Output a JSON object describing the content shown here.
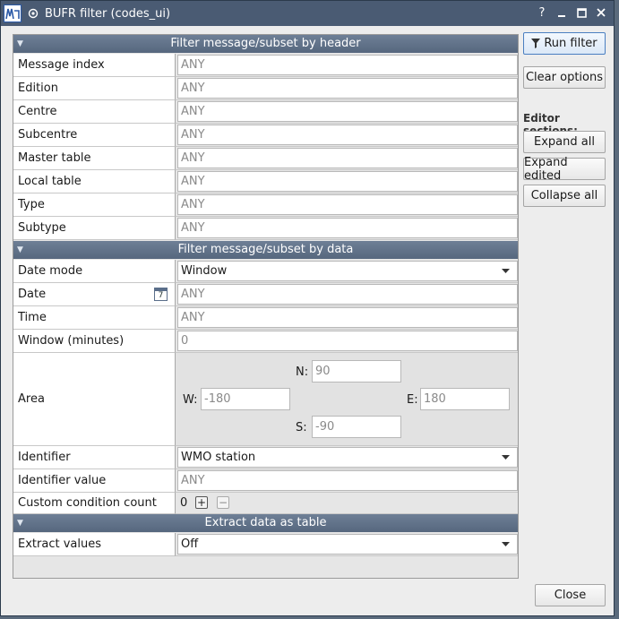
{
  "window": {
    "title": "BUFR filter (codes_ui)",
    "help": "?",
    "minimize": "_",
    "maximize": "□",
    "close": "✕"
  },
  "sections": {
    "header": {
      "title": "Filter message/subset by header"
    },
    "data": {
      "title": "Filter message/subset by data"
    },
    "extract": {
      "title": "Extract data as table"
    }
  },
  "header_rows": [
    {
      "label": "Message index",
      "placeholder": "ANY"
    },
    {
      "label": "Edition",
      "placeholder": "ANY"
    },
    {
      "label": "Centre",
      "placeholder": "ANY"
    },
    {
      "label": "Subcentre",
      "placeholder": "ANY"
    },
    {
      "label": "Master table",
      "placeholder": "ANY"
    },
    {
      "label": "Local table",
      "placeholder": "ANY"
    },
    {
      "label": "Type",
      "placeholder": "ANY"
    },
    {
      "label": "Subtype",
      "placeholder": "ANY"
    }
  ],
  "data_rows": {
    "date_mode": {
      "label": "Date mode",
      "value": "Window"
    },
    "date": {
      "label": "Date",
      "placeholder": "ANY",
      "calendar_day": "7"
    },
    "time": {
      "label": "Time",
      "placeholder": "ANY"
    },
    "window": {
      "label": "Window (minutes)",
      "placeholder": "0"
    },
    "area": {
      "label": "Area",
      "n_label": "N:",
      "n_value": "90",
      "w_label": "W:",
      "w_value": "-180",
      "e_label": "E:",
      "e_value": "180",
      "s_label": "S:",
      "s_value": "-90"
    },
    "identifier": {
      "label": "Identifier",
      "value": "WMO station"
    },
    "identifier_value": {
      "label": "Identifier value",
      "placeholder": "ANY"
    },
    "custom_count": {
      "label": "Custom condition count",
      "value": "0"
    }
  },
  "extract_rows": {
    "extract_values": {
      "label": "Extract values",
      "value": "Off"
    }
  },
  "side": {
    "run_filter": "Run filter",
    "clear_options": "Clear options",
    "editor_sections": "Editor sections:",
    "expand_all": "Expand all",
    "expand_edited": "Expand edited",
    "collapse_all": "Collapse all",
    "close": "Close"
  },
  "colors": {
    "titlebar": "#4a5b73",
    "section_header": "#5f708a",
    "accent": "#4a7fc1"
  }
}
